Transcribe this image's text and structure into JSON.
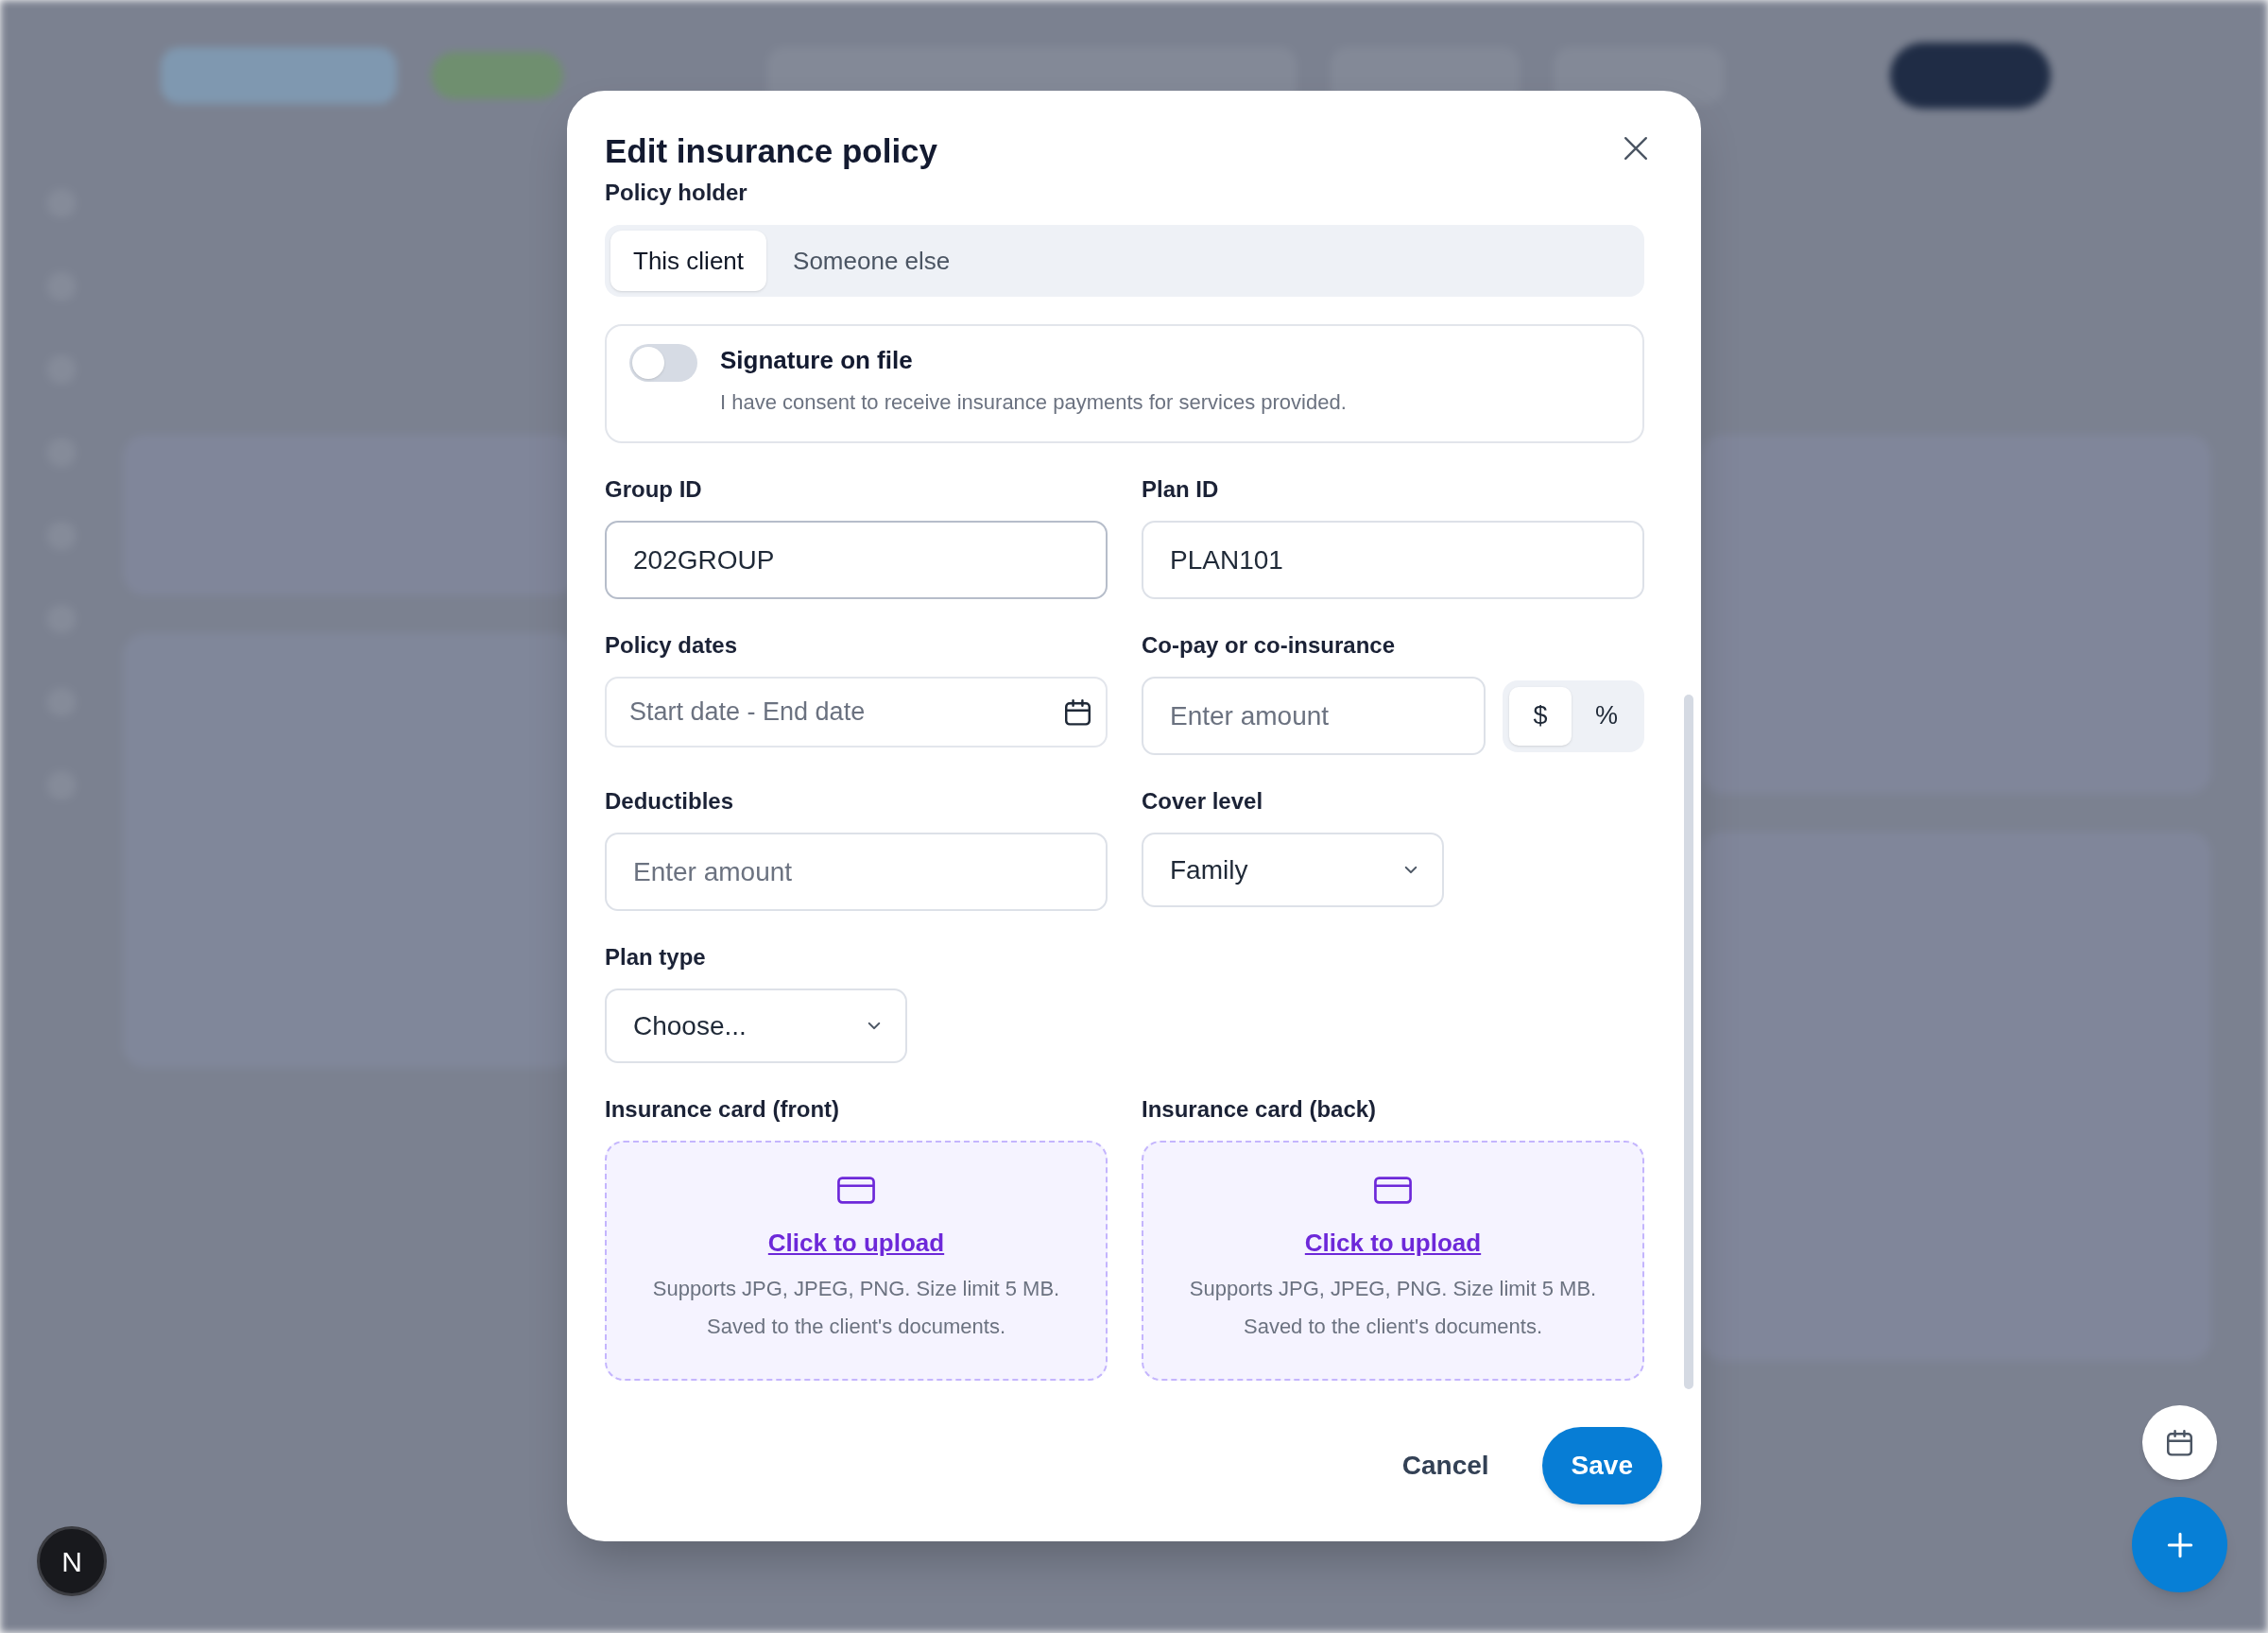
{
  "dialog": {
    "title": "Edit insurance policy",
    "policy_holder": {
      "label": "Policy holder",
      "options": [
        {
          "label": "This client",
          "selected": true
        },
        {
          "label": "Someone else",
          "selected": false
        }
      ]
    },
    "signature": {
      "title": "Signature on file",
      "description": "I have consent to receive insurance payments for services provided.",
      "on": false
    },
    "fields": [
      {
        "kind": "text",
        "label": "Group ID",
        "value": "202GROUP",
        "focused": true
      },
      {
        "kind": "text",
        "label": "Plan ID",
        "value": "PLAN101",
        "focused": false
      },
      {
        "kind": "date_range",
        "label": "Policy dates",
        "placeholder": "Start date - End date"
      },
      {
        "kind": "amount_unit",
        "label": "Co-pay or co-insurance",
        "placeholder": "Enter amount",
        "units": [
          {
            "label": "$",
            "selected": true
          },
          {
            "label": "%",
            "selected": false
          }
        ]
      },
      {
        "kind": "text",
        "label": "Deductibles",
        "placeholder": "Enter amount",
        "focused": false
      },
      {
        "kind": "select",
        "label": "Cover level",
        "value": "Family"
      },
      {
        "kind": "select",
        "label": "Plan type",
        "value": "Choose..."
      }
    ],
    "uploads": [
      {
        "label": "Insurance card (front)",
        "link": "Click to upload",
        "notes": [
          "Supports JPG, JPEG, PNG. Size limit 5 MB.",
          "Saved to the client's documents."
        ]
      },
      {
        "label": "Insurance card (back)",
        "link": "Click to upload",
        "notes": [
          "Supports JPG, JPEG, PNG. Size limit 5 MB.",
          "Saved to the client's documents."
        ]
      }
    ],
    "buttons": [
      {
        "kind": "secondary",
        "label": "Cancel"
      },
      {
        "kind": "primary",
        "label": "Save"
      }
    ]
  },
  "dev_indicator": {
    "label": "N"
  }
}
